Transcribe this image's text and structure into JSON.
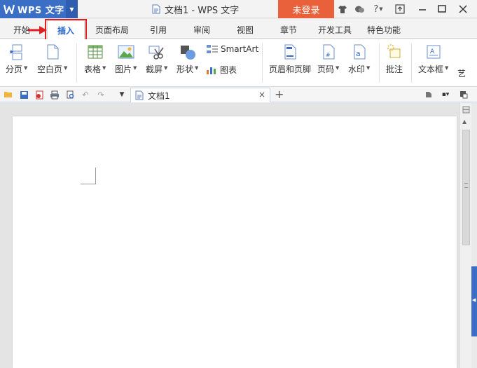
{
  "titlebar": {
    "app_name": "WPS 文字",
    "doc_title": "文档1 - WPS 文字",
    "login_label": "未登录"
  },
  "menu": {
    "tabs": [
      {
        "label": "开始"
      },
      {
        "label": "插入"
      },
      {
        "label": "页面布局"
      },
      {
        "label": "引用"
      },
      {
        "label": "审阅"
      },
      {
        "label": "视图"
      },
      {
        "label": "章节"
      },
      {
        "label": "开发工具"
      },
      {
        "label": "特色功能"
      }
    ],
    "active_tab": "插入"
  },
  "ribbon": {
    "items": [
      {
        "label": "分页",
        "icon": "page-break-icon"
      },
      {
        "label": "空白页",
        "icon": "blank-page-icon"
      },
      {
        "label": "表格",
        "icon": "table-icon"
      },
      {
        "label": "图片",
        "icon": "picture-icon"
      },
      {
        "label": "截屏",
        "icon": "screenshot-icon"
      },
      {
        "label": "形状",
        "icon": "shapes-icon"
      },
      {
        "label": "SmartArt",
        "icon": "smartart-icon"
      },
      {
        "label": "图表",
        "icon": "chart-icon"
      },
      {
        "label": "页眉和页脚",
        "icon": "header-footer-icon"
      },
      {
        "label": "页码",
        "icon": "page-number-icon"
      },
      {
        "label": "水印",
        "icon": "watermark-icon"
      },
      {
        "label": "批注",
        "icon": "comment-icon"
      },
      {
        "label": "文本框",
        "icon": "textbox-icon"
      },
      {
        "label": "艺",
        "icon": "wordart-icon"
      }
    ]
  },
  "doc_tabs": {
    "current": "文档1",
    "new_tab_symbol": "+",
    "close_symbol": "×"
  },
  "colors": {
    "brand": "#3b6fc6",
    "login": "#e8613b",
    "highlight": "#e02020",
    "active_tab_text": "#2a66d1"
  }
}
